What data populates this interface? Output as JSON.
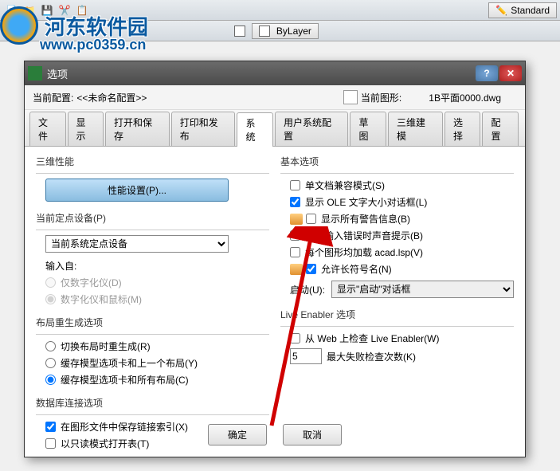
{
  "watermark": {
    "name": "河东软件园",
    "url": "www.pc0359.cn"
  },
  "toolbar": {
    "standard": "Standard",
    "bylayer": "ByLayer"
  },
  "dialog": {
    "title": "选项",
    "current_profile_label": "当前配置:",
    "current_profile_value": "<<未命名配置>>",
    "current_drawing_label": "当前图形:",
    "current_drawing_value": "1B平面0000.dwg",
    "tabs": [
      "文件",
      "显示",
      "打开和保存",
      "打印和发布",
      "系统",
      "用户系统配置",
      "草图",
      "三维建模",
      "选择",
      "配置"
    ],
    "active_tab": 4,
    "groups": {
      "perf3d": {
        "title": "三维性能",
        "button": "性能设置(P)..."
      },
      "pointer": {
        "title": "当前定点设备(P)",
        "select_value": "当前系统定点设备",
        "input_from": "输入自:",
        "opt1": "仅数字化仪(D)",
        "opt2": "数字化仪和鼠标(M)"
      },
      "layout": {
        "title": "布局重生成选项",
        "opt1": "切换布局时重生成(R)",
        "opt2": "缓存模型选项卡和上一个布局(Y)",
        "opt3": "缓存模型选项卡和所有布局(C)"
      },
      "db": {
        "title": "数据库连接选项",
        "opt1": "在图形文件中保存链接索引(X)",
        "opt2": "以只读模式打开表(T)"
      },
      "basic": {
        "title": "基本选项",
        "opt1": "单文档兼容模式(S)",
        "opt2": "显示 OLE 文字大小对话框(L)",
        "opt3": "显示所有警告信息(B)",
        "opt4": "用户输入错误时声音提示(B)",
        "opt5": "每个图形均加载 acad.lsp(V)",
        "opt6": "允许长符号名(N)",
        "startup_label": "启动(U):",
        "startup_value": "显示\"启动\"对话框"
      },
      "live": {
        "title": "Live Enabler 选项",
        "opt1": "从 Web 上检查 Live Enabler(W)",
        "max_fail_value": "5",
        "max_fail_label": "最大失败检查次数(K)"
      }
    },
    "buttons": {
      "ok": "确定",
      "cancel": "取消"
    }
  }
}
